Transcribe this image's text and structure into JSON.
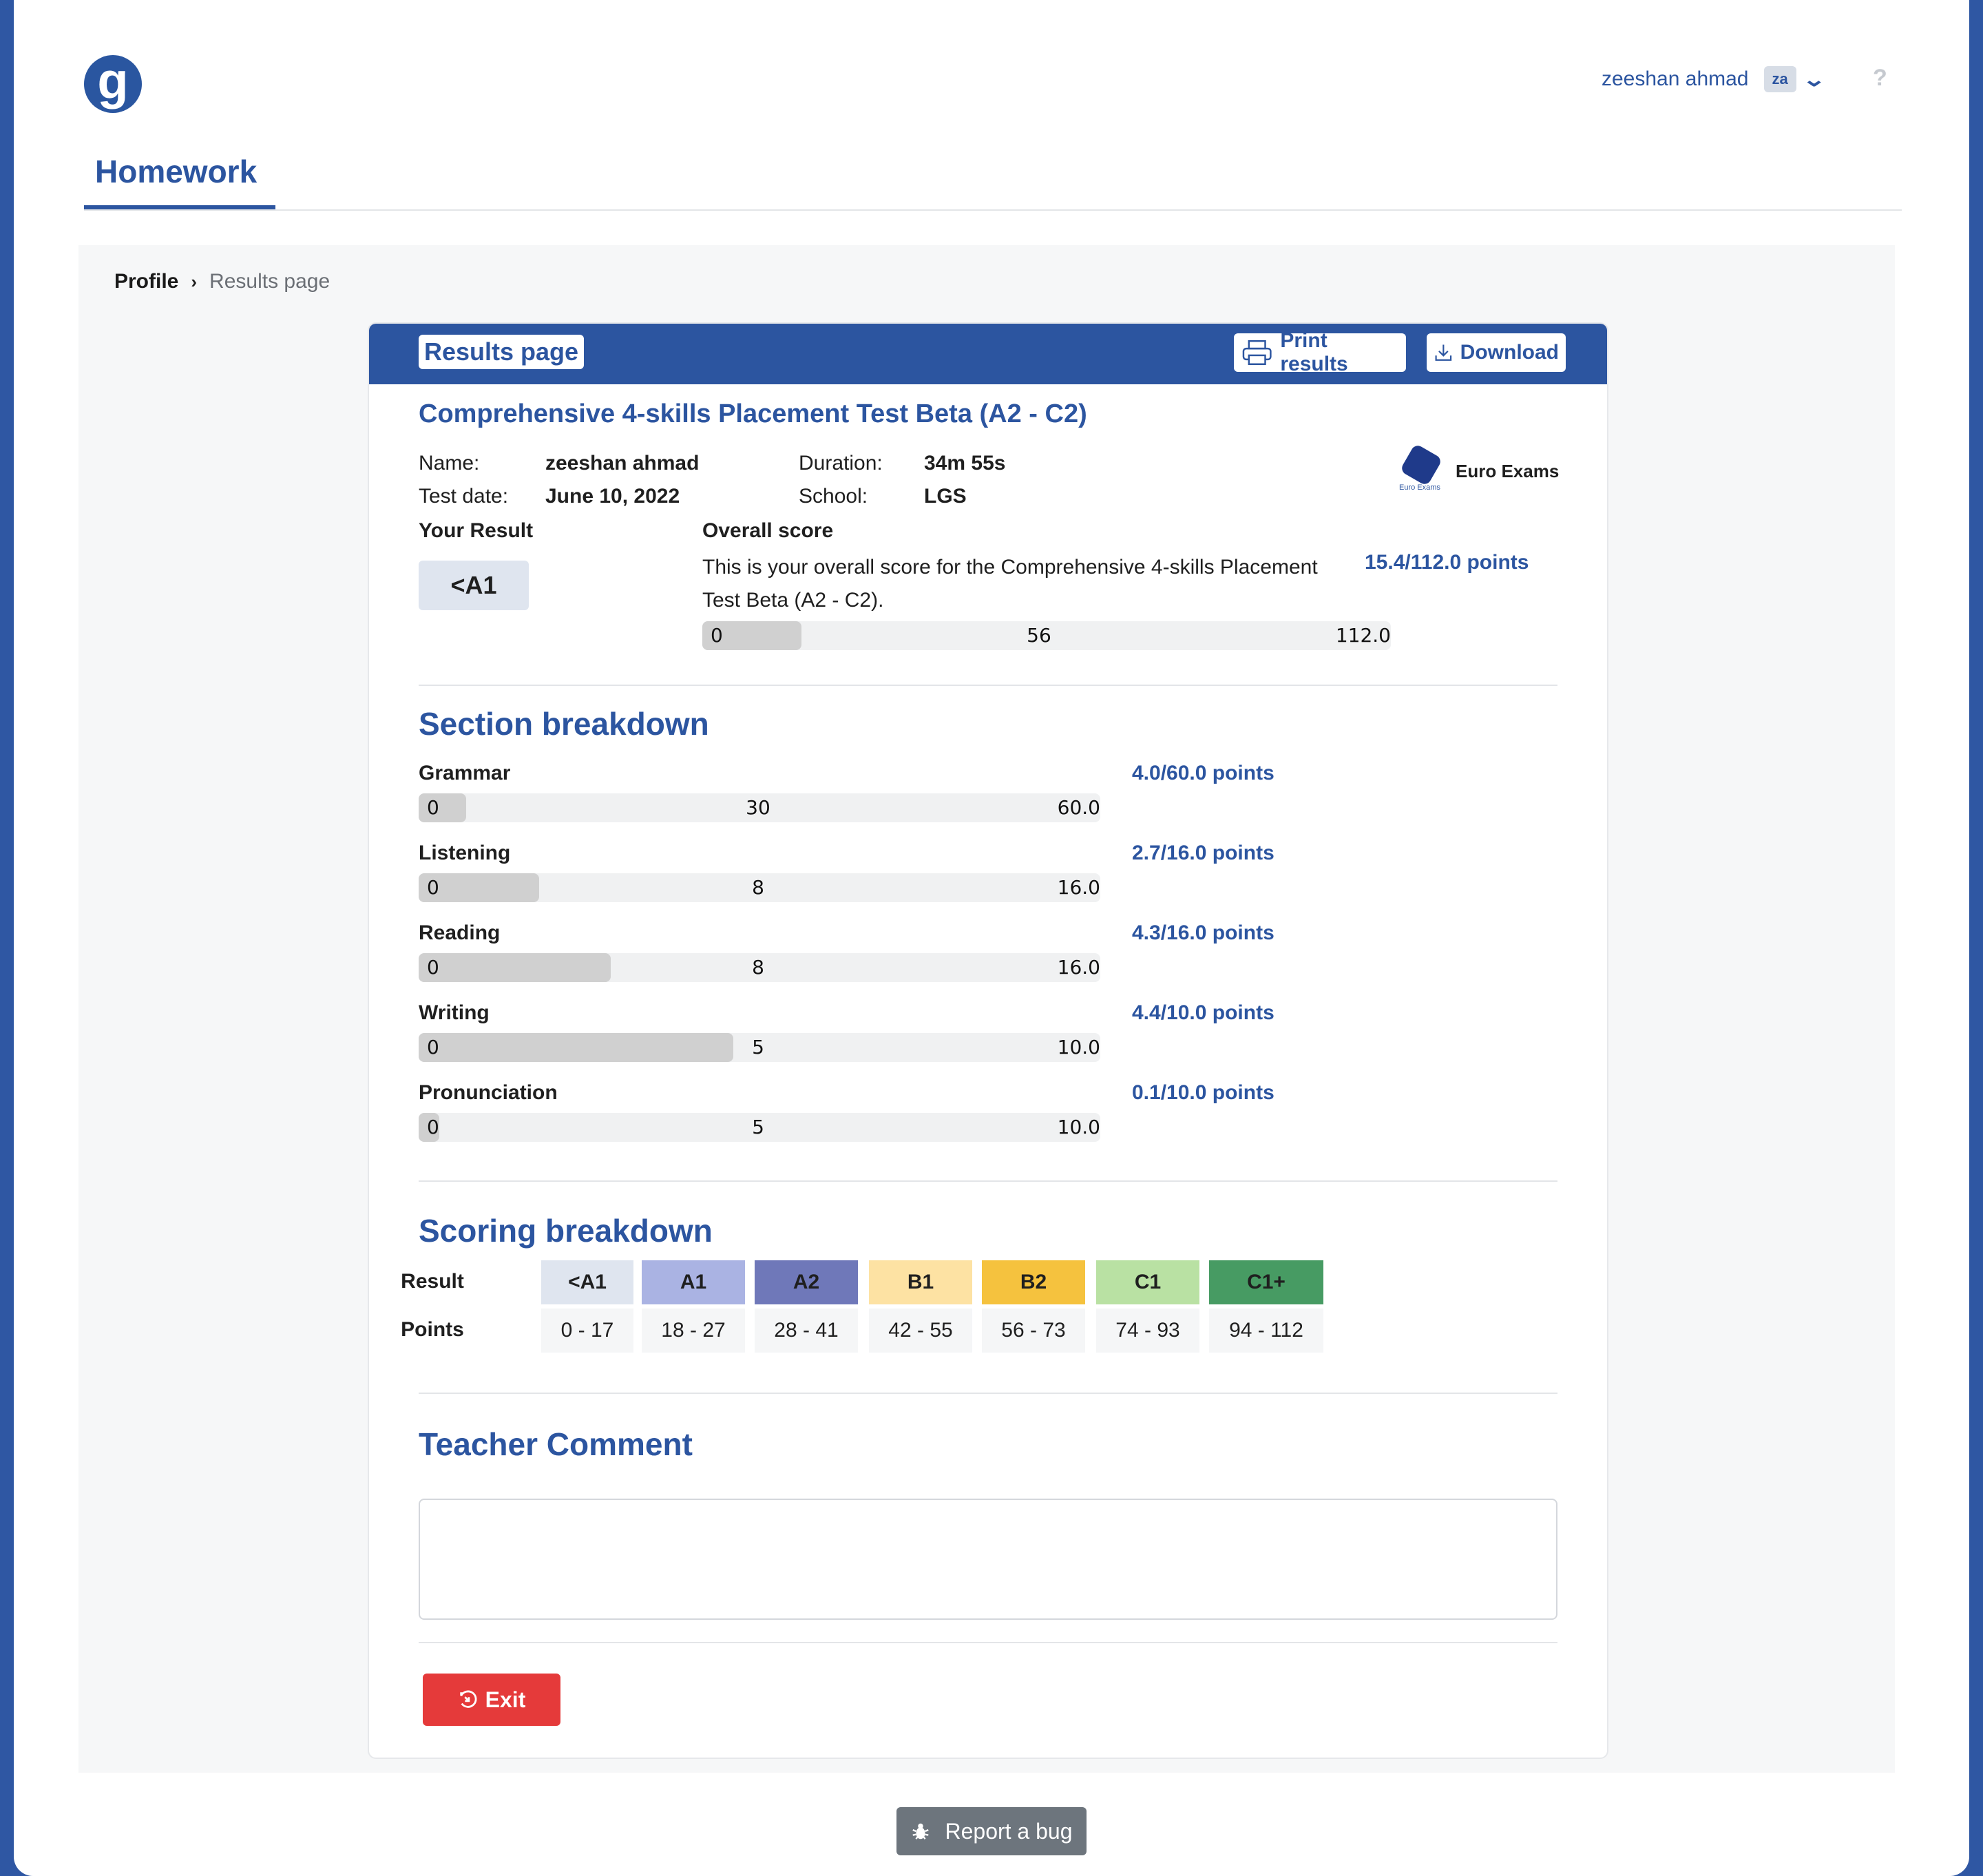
{
  "header": {
    "logo_letter": "g",
    "user_name": "zeeshan ahmad",
    "user_initials": "za",
    "help": "?",
    "nav_tab": "Homework"
  },
  "breadcrumb": {
    "profile": "Profile",
    "sep": "›",
    "current": "Results page"
  },
  "card": {
    "title": "Results page",
    "print_label": "Print results",
    "download_label": "Download",
    "test_title": "Comprehensive 4-skills Placement Test Beta (A2 - C2)",
    "name_label": "Name:",
    "name_value": "zeeshan ahmad",
    "date_label": "Test date:",
    "date_value": "June 10, 2022",
    "duration_label": "Duration:",
    "duration_value": "34m 55s",
    "school_label": "School:",
    "school_value": "LGS",
    "provider": "Euro Exams",
    "provider_caption": "Euro Exams",
    "your_result_label": "Your Result",
    "your_result": "<A1",
    "overall_label": "Overall score",
    "overall_text": "This is your overall score for the Comprehensive 4-skills Placement Test Beta (A2 - C2).",
    "overall_points": "15.4/112.0 points",
    "overall_bar": {
      "min": "0",
      "mid": "56",
      "max": "112.0",
      "value": 15.4,
      "max_value": 112
    }
  },
  "sections": {
    "heading": "Section breakdown",
    "items": [
      {
        "name": "Grammar",
        "points": "4.0/60.0 points",
        "min": "0",
        "mid": "30",
        "max": "60.0",
        "value": 4.0,
        "max_value": 60
      },
      {
        "name": "Listening",
        "points": "2.7/16.0 points",
        "min": "0",
        "mid": "8",
        "max": "16.0",
        "value": 2.7,
        "max_value": 16
      },
      {
        "name": "Reading",
        "points": "4.3/16.0 points",
        "min": "0",
        "mid": "8",
        "max": "16.0",
        "value": 4.3,
        "max_value": 16
      },
      {
        "name": "Writing",
        "points": "4.4/10.0 points",
        "min": "0",
        "mid": "5",
        "max": "10.0",
        "value": 4.4,
        "max_value": 10
      },
      {
        "name": "Pronunciation",
        "points": "0.1/10.0 points",
        "min": "0",
        "mid": "5",
        "max": "10.0",
        "value": 0.1,
        "max_value": 10
      }
    ]
  },
  "scoring": {
    "heading": "Scoring breakdown",
    "result_label": "Result",
    "points_label": "Points",
    "levels": [
      {
        "level": "<A1",
        "range": "0 - 17",
        "color": "#dfe5ef"
      },
      {
        "level": "A1",
        "range": "18 - 27",
        "color": "#aab3e3"
      },
      {
        "level": "A2",
        "range": "28 - 41",
        "color": "#6f78b9"
      },
      {
        "level": "B1",
        "range": "42 - 55",
        "color": "#fde2a3"
      },
      {
        "level": "B2",
        "range": "56 - 73",
        "color": "#f5c23e"
      },
      {
        "level": "C1",
        "range": "74 - 93",
        "color": "#b9e1a3"
      },
      {
        "level": "C1+",
        "range": "94 - 112",
        "color": "#479b63"
      }
    ]
  },
  "comment": {
    "heading": "Teacher Comment",
    "value": ""
  },
  "actions": {
    "exit_label": "Exit",
    "report_bug_label": "Report a bug"
  },
  "colors": {
    "brand": "#2c55a0",
    "exit": "#e53a3a",
    "bug_button": "#6d757d"
  }
}
